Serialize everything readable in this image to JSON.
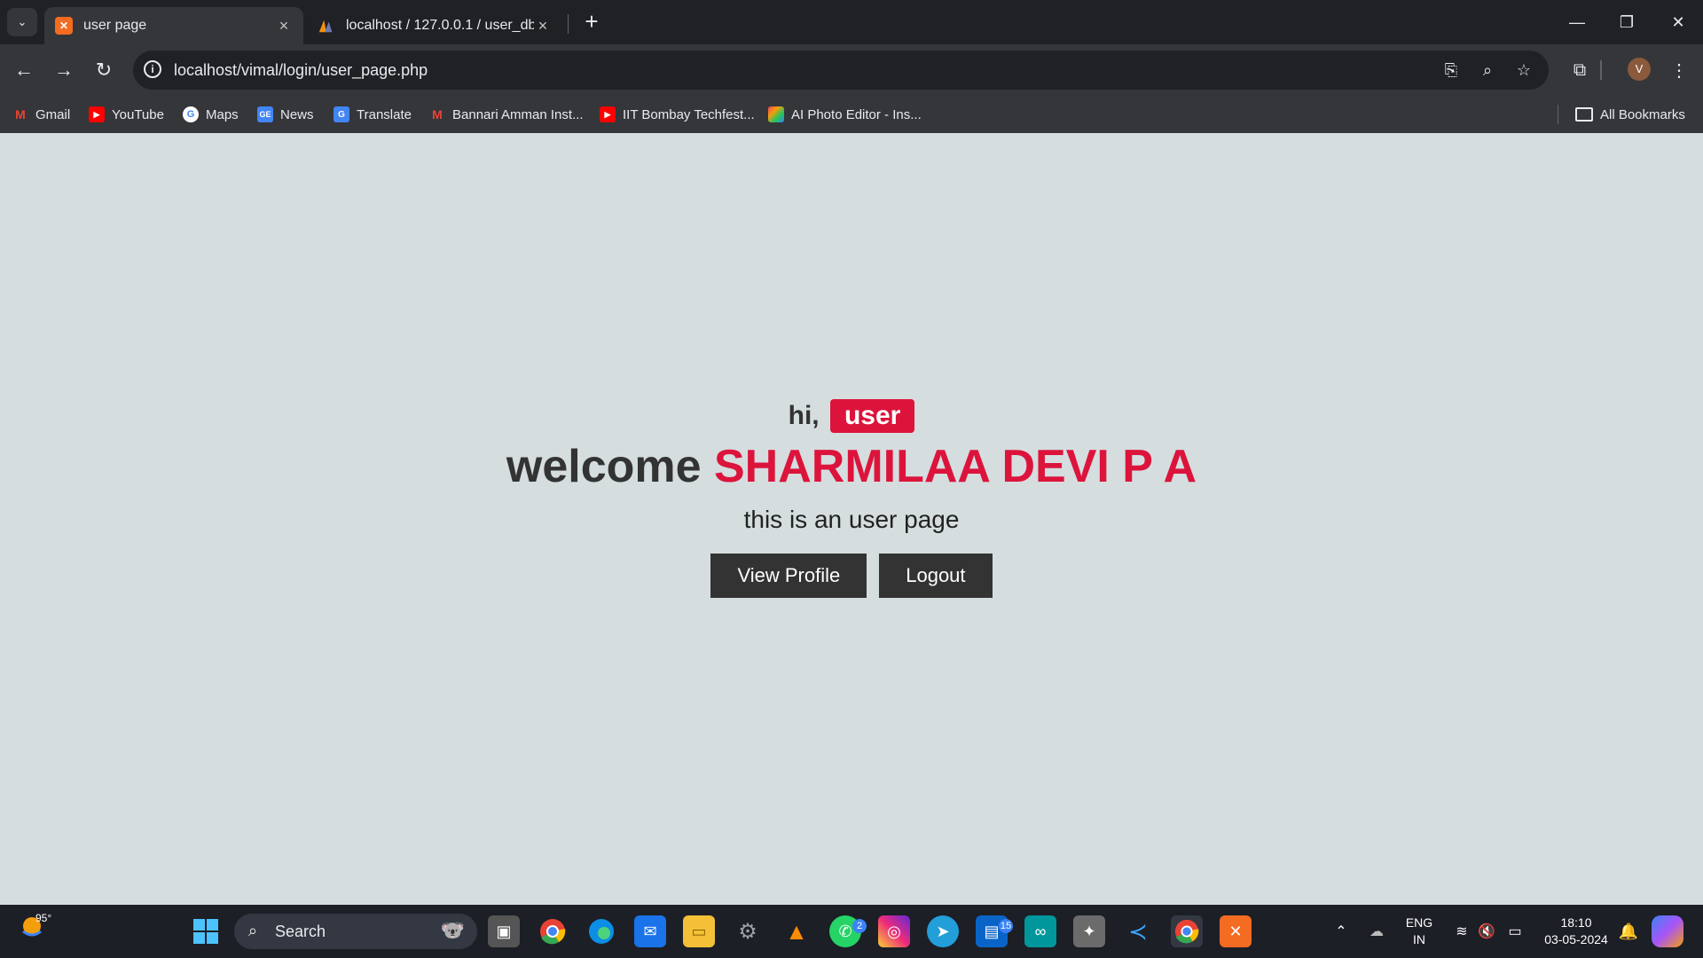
{
  "browser": {
    "tabs": [
      {
        "title": "user page",
        "active": true
      },
      {
        "title": "localhost / 127.0.0.1 / user_db /",
        "active": false
      }
    ],
    "url": "localhost/vimal/login/user_page.php",
    "profile_initial": "V",
    "bookmarks": [
      "Gmail",
      "YouTube",
      "Maps",
      "News",
      "Translate",
      "Bannari Amman Inst...",
      "IIT Bombay Techfest...",
      "AI Photo Editor - Ins..."
    ],
    "all_bookmarks": "All Bookmarks"
  },
  "page": {
    "greeting_prefix": "hi,",
    "user_badge": "user",
    "welcome_prefix": "welcome",
    "user_name": "SHARMILAA DEVI P A",
    "subtitle": "this is an user page",
    "buttons": {
      "view_profile": "View Profile",
      "logout": "Logout"
    },
    "colors": {
      "accent": "#dc143c",
      "background": "#d5dddf",
      "button": "#333333"
    }
  },
  "taskbar": {
    "weather": "95°",
    "search_placeholder": "Search",
    "badges": {
      "whatsapp": "2",
      "outlook": "15"
    },
    "language": "ENG",
    "region": "IN",
    "time": "18:10",
    "date": "03-05-2024"
  }
}
